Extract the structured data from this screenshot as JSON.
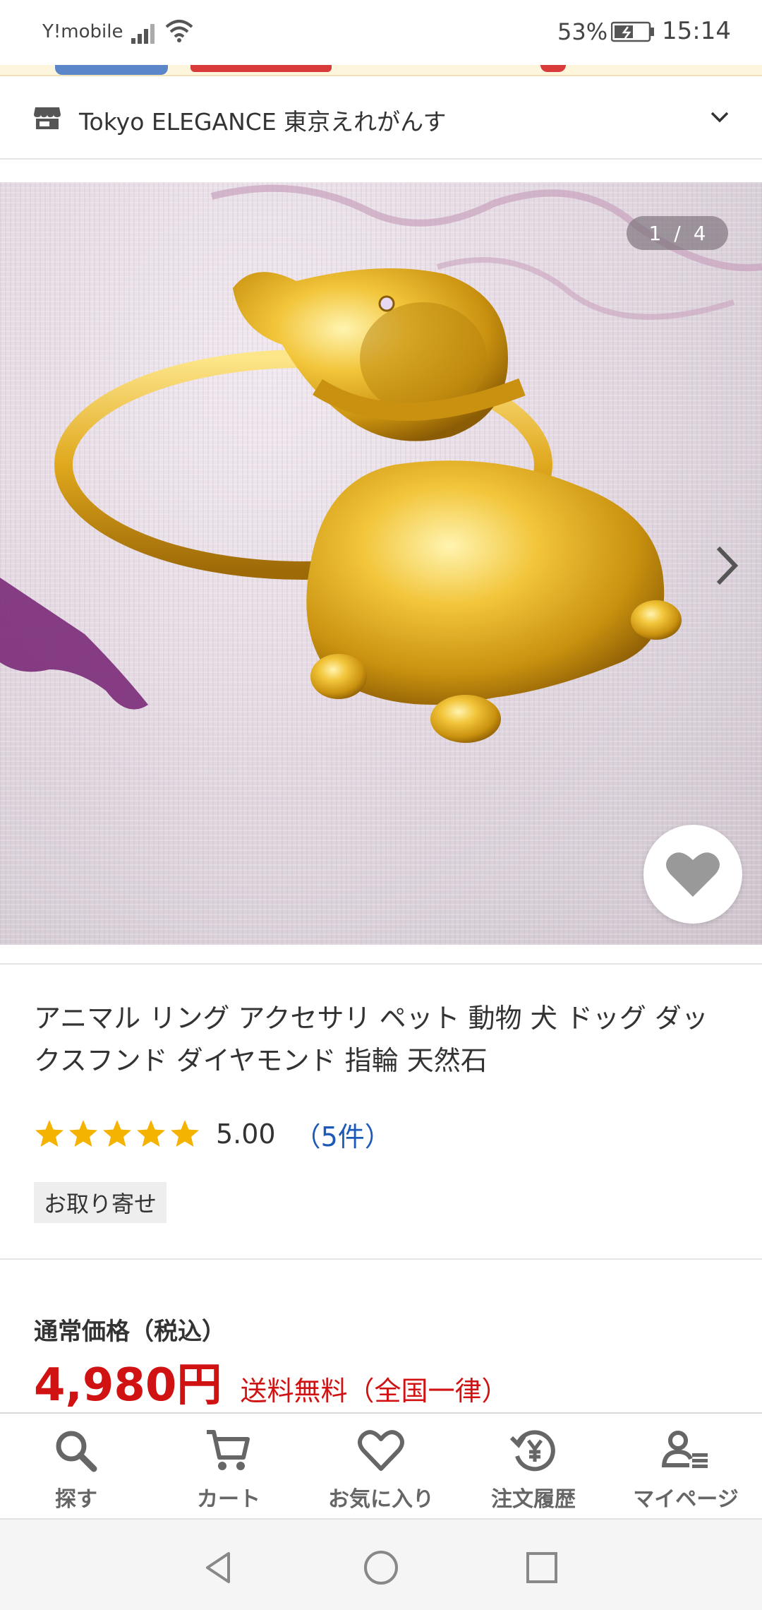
{
  "status_bar": {
    "carrier": "Y!mobile",
    "battery_percent": "53%",
    "time": "15:14"
  },
  "store": {
    "name": "Tokyo ELEGANCE 東京えれがんす",
    "icon": "storefront-icon"
  },
  "gallery": {
    "current": "1",
    "separator": "/",
    "total": "4"
  },
  "product": {
    "title": "アニマル リング アクセサリ ペット 動物 犬 ドッグ ダックスフンド ダイヤモンド 指輪 天然石",
    "rating_value": "5.00",
    "rating_stars": 5,
    "review_count": "（5件）",
    "tag": "お取り寄せ"
  },
  "price": {
    "label": "通常価格（税込）",
    "value": "4,980円",
    "shipping": "送料無料（全国一律）"
  },
  "tabs": [
    {
      "label": "探す",
      "icon": "search-icon"
    },
    {
      "label": "カート",
      "icon": "cart-icon"
    },
    {
      "label": "お気に入り",
      "icon": "heart-icon"
    },
    {
      "label": "注文履歴",
      "icon": "order-history-icon"
    },
    {
      "label": "マイページ",
      "icon": "my-page-icon"
    }
  ],
  "colors": {
    "price_red": "#d01212",
    "link_blue": "#1d5ab8",
    "star_gold": "#f5b301",
    "tab_gray": "#666666"
  }
}
